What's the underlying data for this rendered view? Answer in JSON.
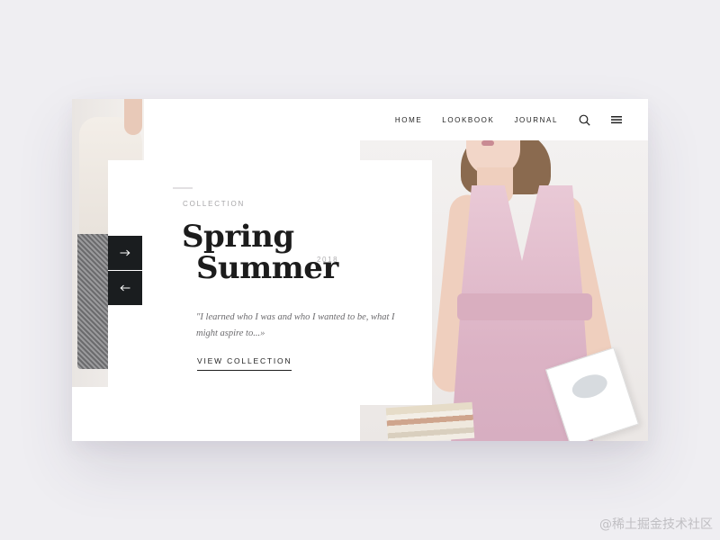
{
  "nav": {
    "items": [
      "HOME",
      "LOOKBOOK",
      "JOURNAL"
    ],
    "search_icon": "search-icon",
    "menu_icon": "hamburger-menu-icon"
  },
  "hero": {
    "kicker": "COLLECTION",
    "title_line1": "Spring",
    "title_line2": "Summer",
    "year": "2018",
    "quote": "\"I learned who I was and who I wanted to be, what I might aspire to...»",
    "cta": "VIEW COLLECTION"
  },
  "slider": {
    "next_icon": "arrow-right-icon",
    "prev_icon": "arrow-left-icon"
  },
  "watermark": "@稀土掘金技术社区",
  "colors": {
    "background": "#efeef2",
    "card": "#ffffff",
    "text": "#1c1c1c",
    "muted": "#a7a6a8",
    "arrow_bg": "#1a1d1f",
    "dress": "#e2bfcf"
  }
}
